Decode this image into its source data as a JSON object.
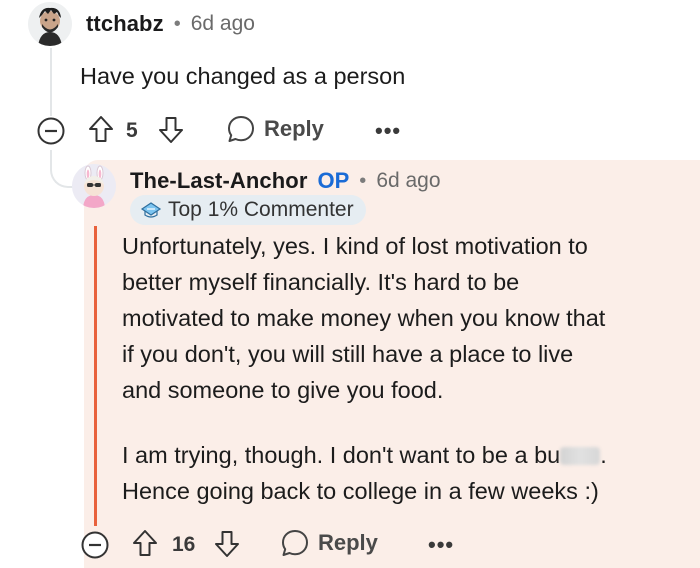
{
  "comment1": {
    "username": "ttchabz",
    "separator": "•",
    "age": "6d ago",
    "body": "Have you changed as a person",
    "score": "5",
    "reply_label": "Reply",
    "more_label": "•••"
  },
  "comment2": {
    "username": "The-Last-Anchor",
    "op_label": "OP",
    "separator": "•",
    "age": "6d ago",
    "flair": "Top 1% Commenter",
    "paragraph1": [
      "Unfortunately, yes. I kind of lost motivation to",
      "better myself financially. It's hard to be",
      "motivated to make money when you know that",
      "if you don't, you will still have a place to live",
      "and someone to give you food."
    ],
    "paragraph2_line1_start": "I am trying, though. I don't want to be a bu",
    "paragraph2_line1_end": ".",
    "paragraph2_line2": "Hence going back to college in a few weeks :)",
    "score": "16",
    "reply_label": "Reply",
    "more_label": "•••"
  },
  "colors": {
    "op_accent": "#e8613c",
    "op_label": "#1a6bd6",
    "reply_background": "#fbeee8",
    "flair_background": "#e6edf2"
  },
  "icons": [
    "avatar",
    "collapse-icon",
    "upvote-icon",
    "downvote-icon",
    "comment-icon",
    "more-icon",
    "flair-icon"
  ]
}
